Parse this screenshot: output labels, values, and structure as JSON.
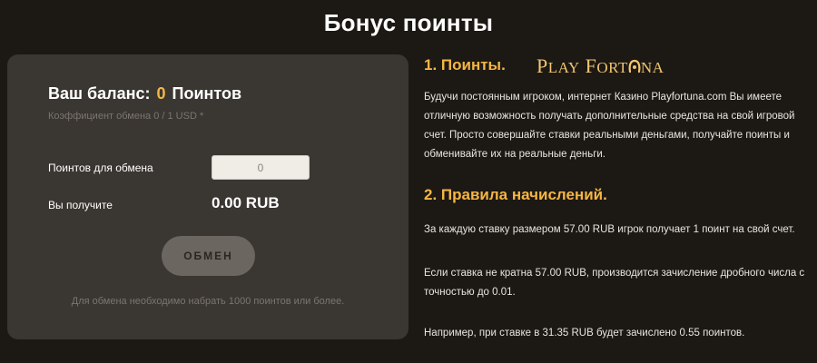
{
  "page_title": "Бонус поинты",
  "card": {
    "balance_label": "Ваш баланс:",
    "balance_value": "0",
    "balance_unit": "Поинтов",
    "rate_text": "Коэффициент обмена 0 / 1 USD *",
    "points_label": "Поинтов для обмена",
    "points_placeholder": "0",
    "receive_label": "Вы получите",
    "receive_amount": "0.00 RUB",
    "exchange_button": "ОБМЕН",
    "note": "Для обмена необходимо набрать 1000 поинтов или более."
  },
  "info": {
    "heading1": "1. Поинты.",
    "logo_part1": "P",
    "logo_part2": "LAY",
    "logo_part3": "F",
    "logo_part4": "ORT",
    "logo_part5": "NA",
    "paragraph1": "Будучи постоянным игроком, интернет Казино Playfortuna.com Вы имеете отличную возможность получать дополнительные средства на свой игровой счет. Просто совершайте ставки реальными деньгами, получайте поинты и обменивайте их на реальные деньги.",
    "heading2": "2. Правила начислений.",
    "paragraph2": "За каждую ставку размером 57.00 RUB игрок получает 1 поинт на свой счет.",
    "paragraph3": "Если ставка не кратна 57.00 RUB, производится зачисление дробного числа с точностью до 0.01.",
    "paragraph4": "Например, при ставке в 31.35 RUB будет зачислено 0.55 поинтов."
  },
  "colors": {
    "background": "#1c1814",
    "card": "#3a3632",
    "accent": "#f5b642",
    "button": "#6b6660"
  }
}
